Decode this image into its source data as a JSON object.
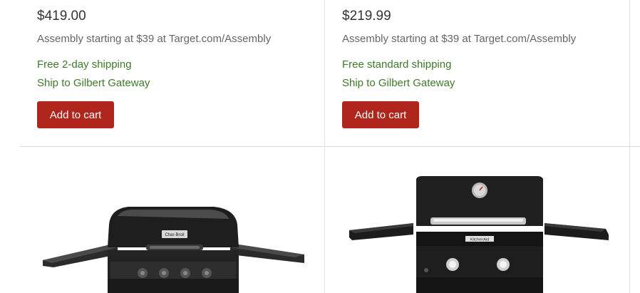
{
  "products": [
    {
      "price": "$419.00",
      "assembly": "Assembly starting at $39 at Target.com/Assembly",
      "shipping": "Free 2-day shipping",
      "ship_to": "Ship to Gilbert Gateway",
      "add_to_cart": "Add to cart",
      "brand_mark": "Char-Broil"
    },
    {
      "price": "$219.99",
      "assembly": "Assembly starting at $39 at Target.com/Assembly",
      "shipping": "Free standard shipping",
      "ship_to": "Ship to Gilbert Gateway",
      "add_to_cart": "Add to cart",
      "brand_mark": "KitchenAid"
    }
  ],
  "colors": {
    "button": "#b1261c",
    "shipping_text": "#3e7a2a",
    "price_text": "#333333",
    "muted_text": "#666666",
    "divider": "#dcdcdc"
  }
}
